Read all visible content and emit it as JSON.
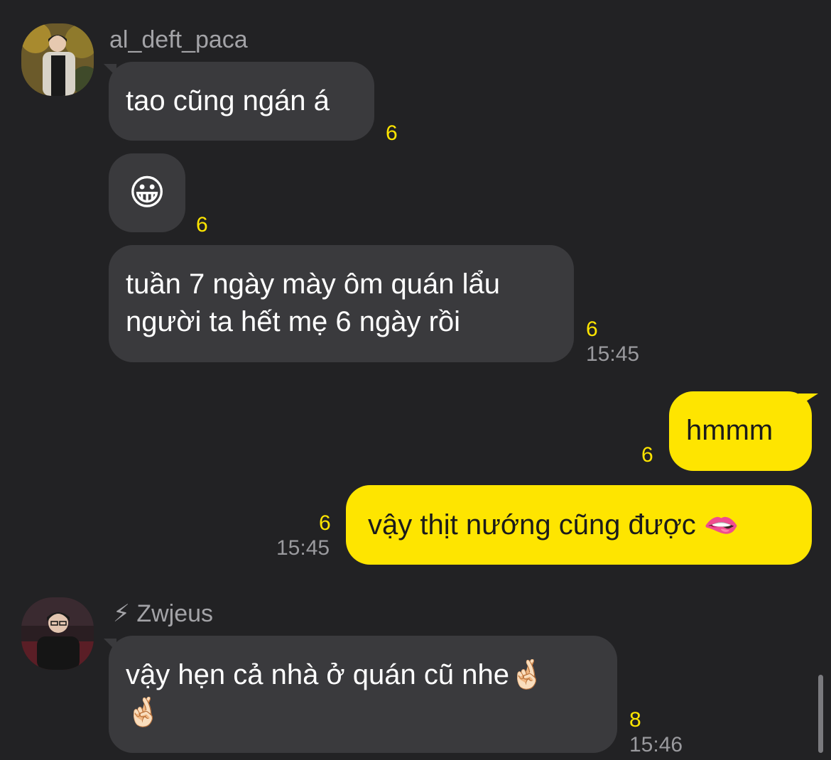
{
  "messages": [
    {
      "sender": "al_deft_paca",
      "text": "tao cũng ngán á",
      "count": "6"
    },
    {
      "text": "😀",
      "count": "6"
    },
    {
      "lines": [
        "tuần 7 ngày mày ôm quán lẩu",
        "người ta hết mẹ 6 ngày rồi"
      ],
      "count": "6",
      "time": "15:45"
    },
    {
      "text": "hmmm",
      "count": "6"
    },
    {
      "text": "vậy thịt nướng cũng được 🫦",
      "count": "6",
      "time": "15:45"
    },
    {
      "sender": "⚡ Zwjeus",
      "lines": [
        "vậy hẹn cả nhà ở quán cũ nhe🤞🏻",
        "🤞🏻"
      ],
      "count": "8",
      "time": "15:46"
    }
  ],
  "colors": {
    "background": "#222224",
    "incoming_bubble": "#3a3a3d",
    "outgoing_bubble": "#fee500",
    "unread_count": "#fee500",
    "timestamp": "#9a9a9e"
  }
}
